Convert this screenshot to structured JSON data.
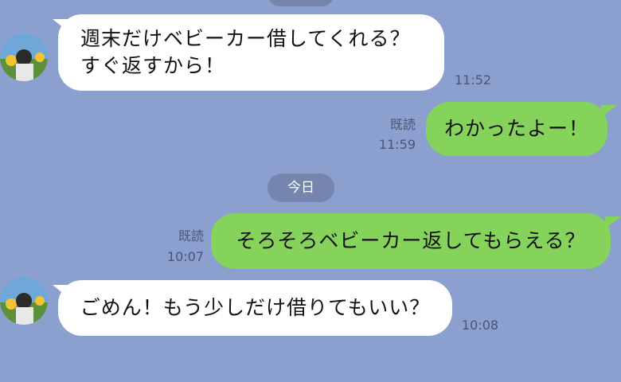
{
  "conversation": {
    "date_separator": "今日",
    "messages": [
      {
        "direction": "incoming",
        "lines": [
          "週末だけベビーカー借してくれる？",
          "すぐ返すから！"
        ],
        "time": "11:52"
      },
      {
        "direction": "outgoing",
        "text": "わかったよー！",
        "read_label": "既読",
        "time": "11:59"
      },
      {
        "direction": "outgoing",
        "text": "そろそろベビーカー返してもらえる？",
        "read_label": "既読",
        "time": "10:07"
      },
      {
        "direction": "incoming",
        "text": "ごめん！もう少しだけ借りてもいい？",
        "time": "10:08"
      }
    ]
  },
  "colors": {
    "background": "#8ca0cf",
    "outgoing_bubble": "#86d35b",
    "incoming_bubble": "#ffffff",
    "separator_pill": "#7585ad"
  }
}
